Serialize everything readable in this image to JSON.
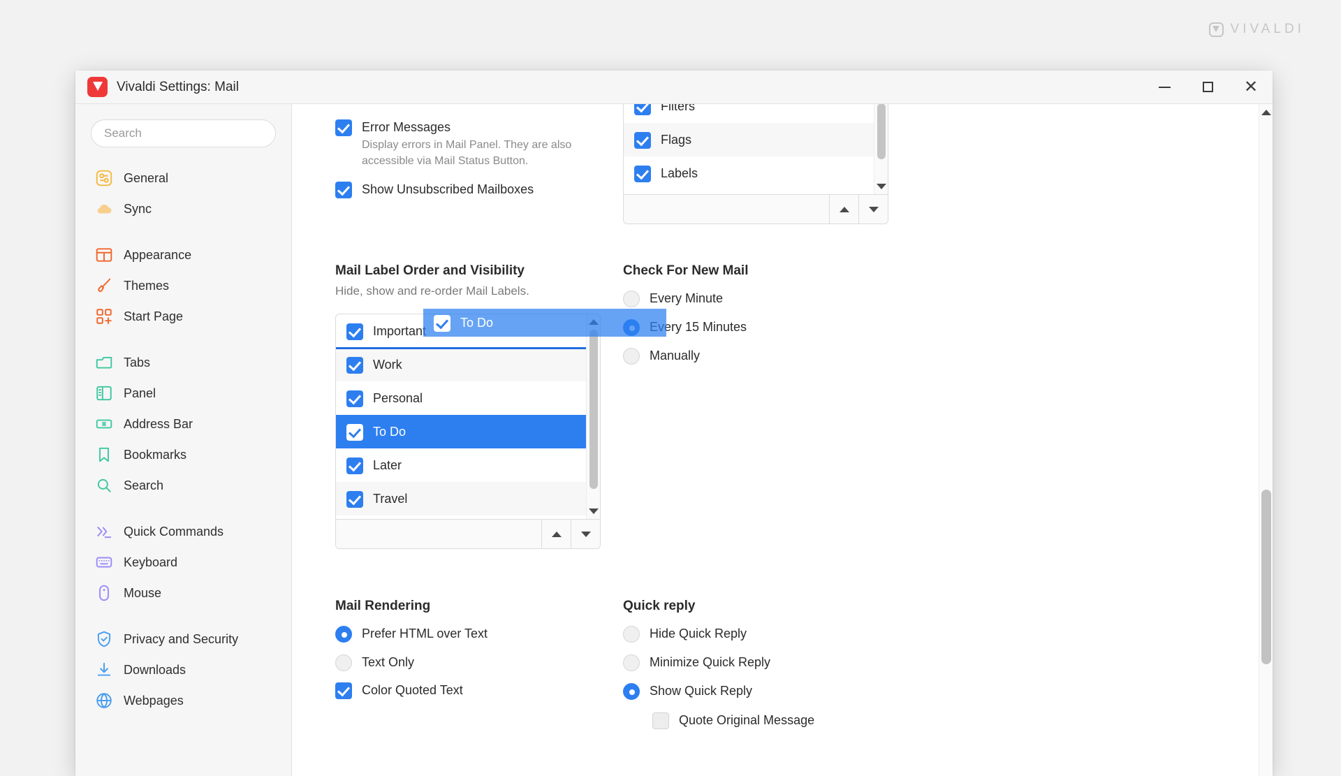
{
  "watermark": {
    "text": "VIVALDI"
  },
  "window": {
    "title": "Vivaldi Settings: Mail",
    "minimize_label": "Minimize",
    "maximize_label": "Maximize",
    "close_label": "Close"
  },
  "sidebar": {
    "search_placeholder": "Search",
    "groups": [
      {
        "items": [
          {
            "label": "General",
            "icon": "general-icon",
            "color": "#f5b942"
          },
          {
            "label": "Sync",
            "icon": "sync-icon",
            "color": "#f7c36b"
          }
        ]
      },
      {
        "items": [
          {
            "label": "Appearance",
            "icon": "appearance-icon",
            "color": "#f2662a"
          },
          {
            "label": "Themes",
            "icon": "themes-icon",
            "color": "#f2662a"
          },
          {
            "label": "Start Page",
            "icon": "start-page-icon",
            "color": "#f2662a"
          }
        ]
      },
      {
        "items": [
          {
            "label": "Tabs",
            "icon": "tabs-icon",
            "color": "#3fc8a0"
          },
          {
            "label": "Panel",
            "icon": "panel-icon",
            "color": "#3fc8a0"
          },
          {
            "label": "Address Bar",
            "icon": "address-bar-icon",
            "color": "#3fc8a0"
          },
          {
            "label": "Bookmarks",
            "icon": "bookmarks-icon",
            "color": "#3fc8a0"
          },
          {
            "label": "Search",
            "icon": "search-icon",
            "color": "#3fc8a0"
          }
        ]
      },
      {
        "items": [
          {
            "label": "Quick Commands",
            "icon": "quick-commands-icon",
            "color": "#9b8cf7"
          },
          {
            "label": "Keyboard",
            "icon": "keyboard-icon",
            "color": "#9b8cf7"
          },
          {
            "label": "Mouse",
            "icon": "mouse-icon",
            "color": "#9b8cf7"
          }
        ]
      },
      {
        "items": [
          {
            "label": "Privacy and Security",
            "icon": "shield-icon",
            "color": "#4a9ef0"
          },
          {
            "label": "Downloads",
            "icon": "download-icon",
            "color": "#4a9ef0"
          },
          {
            "label": "Webpages",
            "icon": "globe-icon",
            "color": "#4a9ef0"
          }
        ]
      }
    ]
  },
  "main": {
    "error_messages": {
      "label": "Error Messages",
      "description": "Display errors in Mail Panel. They are also accessible via Mail Status Button.",
      "checked": true
    },
    "show_unsubscribed": {
      "label": "Show Unsubscribed Mailboxes",
      "checked": true
    },
    "panel_list": {
      "items": [
        {
          "label": "Filters",
          "checked": true
        },
        {
          "label": "Flags",
          "checked": true
        },
        {
          "label": "Labels",
          "checked": true
        }
      ],
      "move_up_label": "Move Up",
      "move_down_label": "Move Down"
    },
    "label_order": {
      "title": "Mail Label Order and Visibility",
      "subtitle": "Hide, show and re-order Mail Labels.",
      "items": [
        {
          "label": "Important",
          "checked": true,
          "selected": false
        },
        {
          "label": "Work",
          "checked": true,
          "selected": false
        },
        {
          "label": "Personal",
          "checked": true,
          "selected": false
        },
        {
          "label": "To Do",
          "checked": true,
          "selected": true
        },
        {
          "label": "Later",
          "checked": true,
          "selected": false
        },
        {
          "label": "Travel",
          "checked": true,
          "selected": false
        }
      ],
      "move_up_label": "Move Up",
      "move_down_label": "Move Down"
    },
    "drag_ghost": {
      "label": "To Do",
      "checked": true
    },
    "check_new_mail": {
      "title": "Check For New Mail",
      "options": [
        {
          "label": "Every Minute",
          "selected": false
        },
        {
          "label": "Every 15 Minutes",
          "selected": true
        },
        {
          "label": "Manually",
          "selected": false
        }
      ]
    },
    "mail_rendering": {
      "title": "Mail Rendering",
      "options": [
        {
          "label": "Prefer HTML over Text",
          "selected": true
        },
        {
          "label": "Text Only",
          "selected": false
        }
      ],
      "color_quoted": {
        "label": "Color Quoted Text",
        "checked": true
      }
    },
    "quick_reply": {
      "title": "Quick reply",
      "options": [
        {
          "label": "Hide Quick Reply",
          "selected": false
        },
        {
          "label": "Minimize Quick Reply",
          "selected": false
        },
        {
          "label": "Show Quick Reply",
          "selected": true
        }
      ],
      "quote_original": {
        "label": "Quote Original Message",
        "checked": false
      }
    }
  },
  "colors": {
    "accent": "#2d7ff0",
    "selection": "#2d7ff0",
    "brand_red": "#ef3939"
  }
}
